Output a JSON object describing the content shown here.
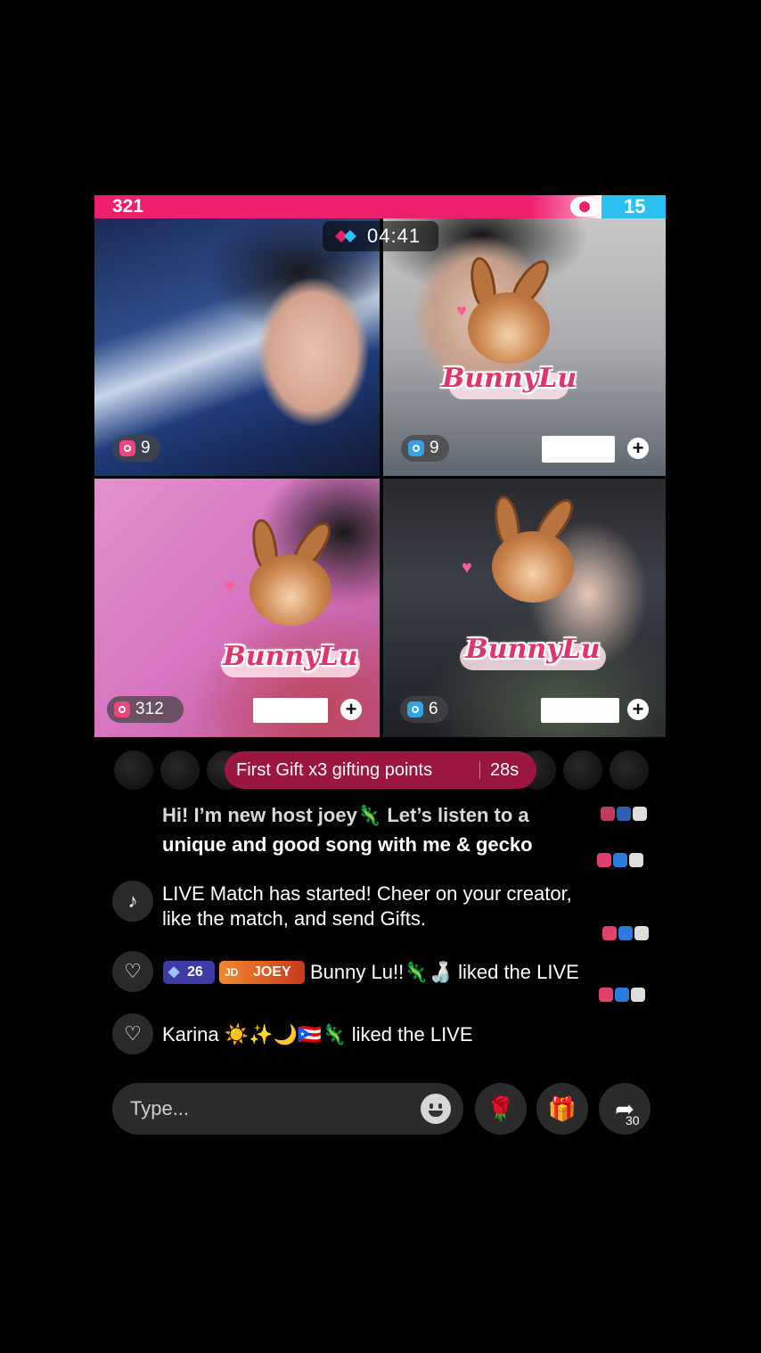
{
  "battle": {
    "score_left": "321",
    "score_right": "15",
    "timer": "04:41",
    "colors": {
      "left": "#ee1f6d",
      "right": "#2cc0f0"
    }
  },
  "tiles": [
    {
      "viewers": "9",
      "team": "pink"
    },
    {
      "viewers": "9",
      "team": "blue"
    },
    {
      "viewers": "312",
      "team": "pink"
    },
    {
      "viewers": "6",
      "team": "blue"
    }
  ],
  "stickers": [
    {
      "label": "BunnyLu",
      "icon": "bunny-sticker"
    },
    {
      "label": "BunnyLu",
      "icon": "bunny-sticker"
    },
    {
      "label": "BunnyLu",
      "icon": "bunny-sticker"
    }
  ],
  "gift_banner": {
    "text": "First Gift x3 gifting points",
    "countdown": "28s"
  },
  "chat": {
    "pinned_line1": "Hi! I’m new host joey🦎 Let’s listen to a",
    "pinned_line2": "unique and good song with me & gecko",
    "system_line1": "LIVE Match has started! Cheer on your creator,",
    "system_line2": "like the match, and send Gifts.",
    "like1": {
      "gem_level": "26",
      "badge": "JOEY",
      "badge_prefix": "JD",
      "text": "Bunny Lu!!🦎🍶 liked the LIVE"
    },
    "like2": {
      "text": "Karina ☀️✨🌙🇵🇷🦎 liked the LIVE"
    }
  },
  "input": {
    "placeholder": "Type...",
    "share_count": "30"
  },
  "icons": {
    "tiktok": "♪",
    "heart": "♡",
    "rose": "🌹",
    "gift": "🎁",
    "share": "➦"
  }
}
